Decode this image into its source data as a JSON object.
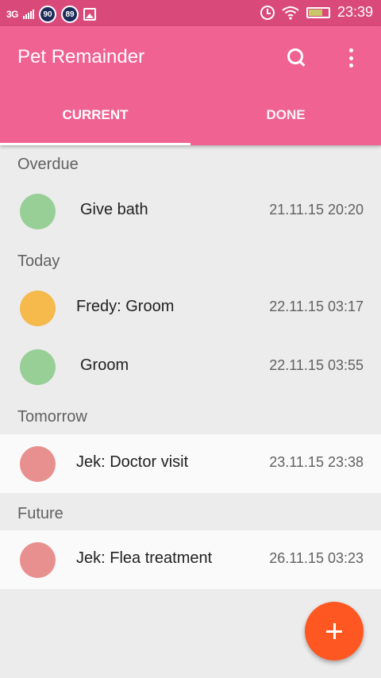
{
  "status_bar": {
    "network": "3G",
    "badges": [
      "90",
      "89"
    ],
    "time": "23:39",
    "battery_level": 0.7
  },
  "app_bar": {
    "title": "Pet Remainder",
    "color": "#f06292",
    "icons": [
      "search-icon",
      "more-vert-icon"
    ]
  },
  "tabs": [
    {
      "label": "CURRENT",
      "selected": true
    },
    {
      "label": "DONE",
      "selected": false
    }
  ],
  "sections": [
    {
      "title": "Overdue",
      "items": [
        {
          "title": "Give bath",
          "date": "21.11.15 20:20",
          "color": "#97cf97"
        }
      ]
    },
    {
      "title": "Today",
      "items": [
        {
          "title": "Fredy: Groom",
          "date": "22.11.15 03:17",
          "color": "#f5b94c"
        },
        {
          "title": "Groom",
          "date": "22.11.15 03:55",
          "color": "#97cf97"
        }
      ]
    },
    {
      "title": "Tomorrow",
      "items": [
        {
          "title": "Jek: Doctor visit",
          "date": "23.11.15 23:38",
          "color": "#e89090"
        }
      ]
    },
    {
      "title": "Future",
      "items": [
        {
          "title": "Jek: Flea treatment",
          "date": "26.11.15 03:23",
          "color": "#e89090"
        }
      ]
    }
  ],
  "fab": {
    "icon": "add-icon",
    "color": "#ff5722"
  }
}
